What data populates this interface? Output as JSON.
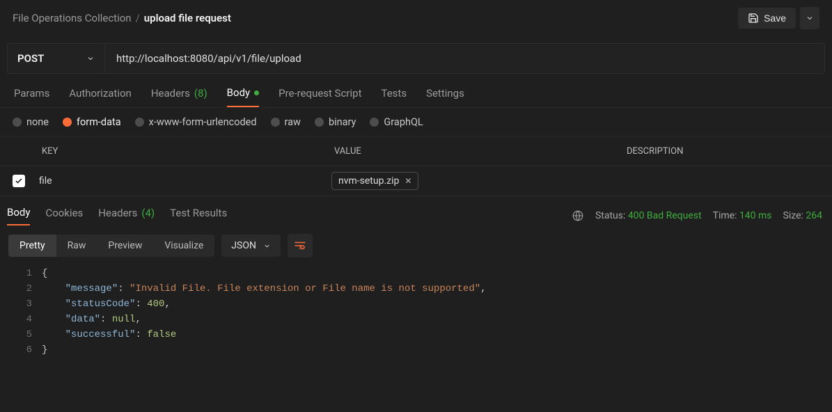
{
  "breadcrumb": {
    "collection": "File Operations Collection",
    "sep": "/",
    "current": "upload file request"
  },
  "top": {
    "save": "Save"
  },
  "request": {
    "method": "POST",
    "url": "http://localhost:8080/api/v1/file/upload",
    "tabs": {
      "params": "Params",
      "auth": "Authorization",
      "headers_label": "Headers",
      "headers_count": "(8)",
      "body": "Body",
      "prereq": "Pre-request Script",
      "tests": "Tests",
      "settings": "Settings"
    },
    "bodyTypes": {
      "none": "none",
      "form": "form-data",
      "xform": "x-www-form-urlencoded",
      "raw": "raw",
      "binary": "binary",
      "graphql": "GraphQL"
    },
    "table": {
      "key": "KEY",
      "value": "VALUE",
      "desc": "DESCRIPTION",
      "row": {
        "key": "file",
        "filename": "nvm-setup.zip"
      }
    }
  },
  "response": {
    "tabs": {
      "body": "Body",
      "cookies": "Cookies",
      "headers_label": "Headers",
      "headers_count": "(4)",
      "tests": "Test Results"
    },
    "meta": {
      "status_label": "Status:",
      "status_value": "400 Bad Request",
      "time_label": "Time:",
      "time_value": "140 ms",
      "size_label": "Size:",
      "size_value": "264"
    },
    "views": {
      "pretty": "Pretty",
      "raw": "Raw",
      "preview": "Preview",
      "visualize": "Visualize",
      "format": "JSON"
    },
    "json": {
      "message": "Invalid File. File extension or File name is not supported",
      "statusCode": 400,
      "data": null,
      "successful": false
    }
  }
}
